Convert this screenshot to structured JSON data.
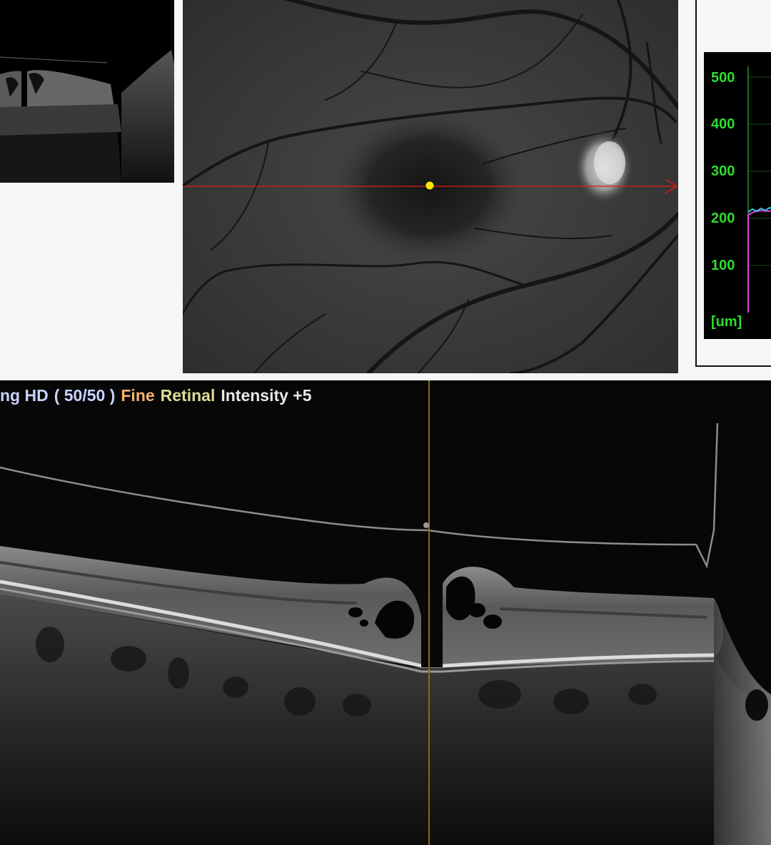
{
  "scan_header": {
    "mode": "ng HD",
    "frames": "( 50/50 )",
    "quality": "Fine",
    "layer": "Retinal",
    "intensity": "Intensity +5"
  },
  "thickness_profile": {
    "y_ticks": [
      "500",
      "400",
      "300",
      "200",
      "100"
    ],
    "unit_label": "[um]"
  },
  "colors": {
    "header_mode": "#c8d2ff",
    "header_quality": "#f5b46e",
    "header_layer": "#dcdc96",
    "header_intensity": "#e8e8e8",
    "axis_text": "#2ddc2d",
    "scan_line": "#e31a1a",
    "fovea_marker": "#ffe800",
    "slice_cursor": "#8a6a10",
    "profile_primary": "#e040e0",
    "profile_secondary": "#40c0e0"
  }
}
